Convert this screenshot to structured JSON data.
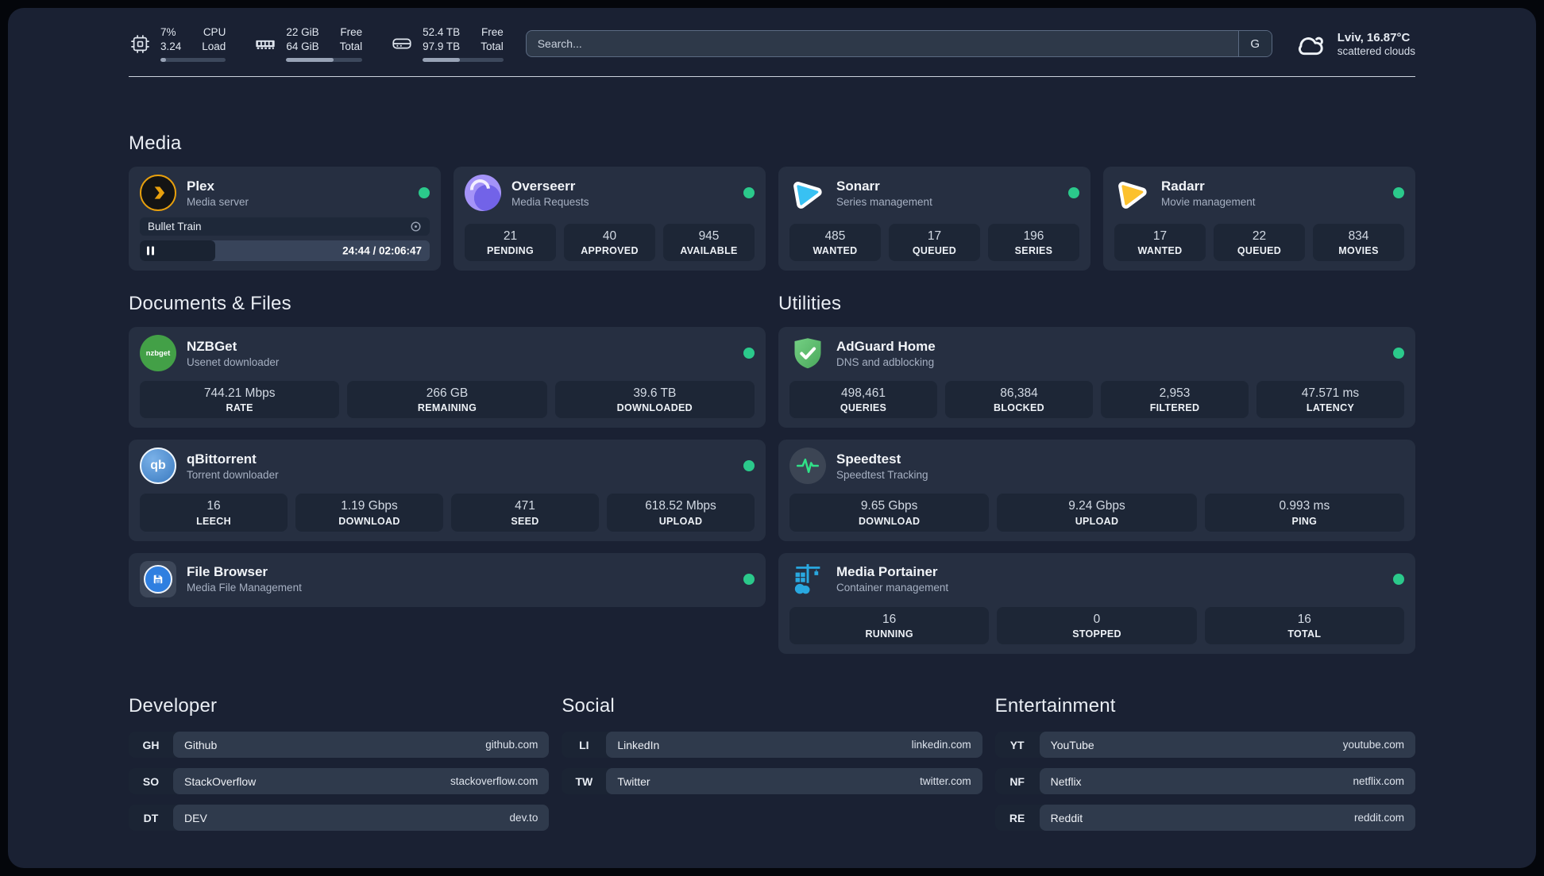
{
  "colors": {
    "status_online": "#2bc98b",
    "plex": "#e8a00d",
    "sonarr": "#38c1f2",
    "radarr": "#fcc12e",
    "nzbget": "#43a047",
    "qbittorrent": "#4a8fd0",
    "adguard": "#5fc46f",
    "speedtest_pulse": "#2ee58a",
    "portainer": "#29a8e0",
    "overseerr": "#8a7cf8"
  },
  "header": {
    "stats": [
      {
        "value": "7%",
        "value2": "3.24",
        "label": "CPU",
        "label2": "Load",
        "progress": 8
      },
      {
        "value": "22 GiB",
        "value2": "64 GiB",
        "label": "Free",
        "label2": "Total",
        "progress": 62
      },
      {
        "value": "52.4 TB",
        "value2": "97.9 TB",
        "label": "Free",
        "label2": "Total",
        "progress": 46
      }
    ],
    "search": {
      "placeholder": "Search...",
      "button": "G"
    },
    "weather": {
      "location": "Lviv, 16.87°C",
      "condition": "scattered clouds"
    }
  },
  "sections": {
    "media": {
      "title": "Media",
      "plex": {
        "name": "Plex",
        "desc": "Media server",
        "track": "Bullet Train",
        "time": "24:44 / 02:06:47",
        "progress": 26
      },
      "overseerr": {
        "name": "Overseerr",
        "desc": "Media Requests",
        "stats": [
          {
            "value": "21",
            "label": "PENDING"
          },
          {
            "value": "40",
            "label": "APPROVED"
          },
          {
            "value": "945",
            "label": "AVAILABLE"
          }
        ]
      },
      "sonarr": {
        "name": "Sonarr",
        "desc": "Series management",
        "stats": [
          {
            "value": "485",
            "label": "WANTED"
          },
          {
            "value": "17",
            "label": "QUEUED"
          },
          {
            "value": "196",
            "label": "SERIES"
          }
        ]
      },
      "radarr": {
        "name": "Radarr",
        "desc": "Movie management",
        "stats": [
          {
            "value": "17",
            "label": "WANTED"
          },
          {
            "value": "22",
            "label": "QUEUED"
          },
          {
            "value": "834",
            "label": "MOVIES"
          }
        ]
      }
    },
    "documents": {
      "title": "Documents & Files",
      "nzbget": {
        "name": "NZBGet",
        "desc": "Usenet downloader",
        "stats": [
          {
            "value": "744.21 Mbps",
            "label": "RATE"
          },
          {
            "value": "266 GB",
            "label": "REMAINING"
          },
          {
            "value": "39.6 TB",
            "label": "DOWNLOADED"
          }
        ]
      },
      "qbittorrent": {
        "name": "qBittorrent",
        "desc": "Torrent downloader",
        "stats": [
          {
            "value": "16",
            "label": "LEECH"
          },
          {
            "value": "1.19 Gbps",
            "label": "DOWNLOAD"
          },
          {
            "value": "471",
            "label": "SEED"
          },
          {
            "value": "618.52 Mbps",
            "label": "UPLOAD"
          }
        ]
      },
      "filebrowser": {
        "name": "File Browser",
        "desc": "Media File Management"
      }
    },
    "utilities": {
      "title": "Utilities",
      "adguard": {
        "name": "AdGuard Home",
        "desc": "DNS and adblocking",
        "stats": [
          {
            "value": "498,461",
            "label": "QUERIES"
          },
          {
            "value": "86,384",
            "label": "BLOCKED"
          },
          {
            "value": "2,953",
            "label": "FILTERED"
          },
          {
            "value": "47.571 ms",
            "label": "LATENCY"
          }
        ]
      },
      "speedtest": {
        "name": "Speedtest",
        "desc": "Speedtest Tracking",
        "stats": [
          {
            "value": "9.65 Gbps",
            "label": "DOWNLOAD"
          },
          {
            "value": "9.24 Gbps",
            "label": "UPLOAD"
          },
          {
            "value": "0.993 ms",
            "label": "PING"
          }
        ]
      },
      "portainer": {
        "name": "Media Portainer",
        "desc": "Container management",
        "stats": [
          {
            "value": "16",
            "label": "RUNNING"
          },
          {
            "value": "0",
            "label": "STOPPED"
          },
          {
            "value": "16",
            "label": "TOTAL"
          }
        ]
      }
    },
    "links": {
      "developer": {
        "title": "Developer",
        "items": [
          {
            "abbr": "GH",
            "name": "Github",
            "url": "github.com"
          },
          {
            "abbr": "SO",
            "name": "StackOverflow",
            "url": "stackoverflow.com"
          },
          {
            "abbr": "DT",
            "name": "DEV",
            "url": "dev.to"
          }
        ]
      },
      "social": {
        "title": "Social",
        "items": [
          {
            "abbr": "LI",
            "name": "LinkedIn",
            "url": "linkedin.com"
          },
          {
            "abbr": "TW",
            "name": "Twitter",
            "url": "twitter.com"
          }
        ]
      },
      "entertainment": {
        "title": "Entertainment",
        "items": [
          {
            "abbr": "YT",
            "name": "YouTube",
            "url": "youtube.com"
          },
          {
            "abbr": "NF",
            "name": "Netflix",
            "url": "netflix.com"
          },
          {
            "abbr": "RE",
            "name": "Reddit",
            "url": "reddit.com"
          }
        ]
      }
    }
  }
}
